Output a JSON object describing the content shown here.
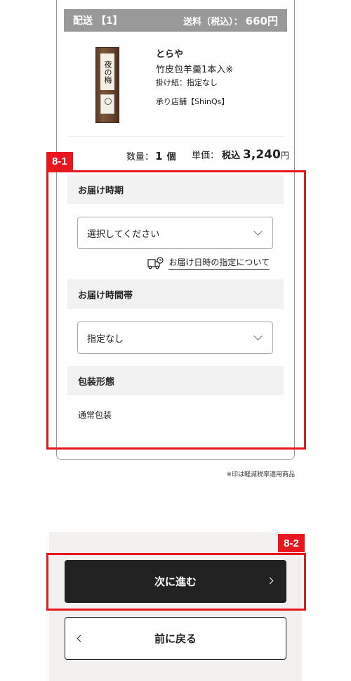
{
  "shipping": {
    "label": "配送 【1】",
    "fee_label": "送料（税込）：",
    "fee_value": "660円"
  },
  "product": {
    "image_label": "夜の梅",
    "brand": "とらや",
    "name": "竹皮包羊羹1本入※",
    "wrapping": "掛け紙：指定なし",
    "store": "承り店舗【ShinQs】"
  },
  "order": {
    "qty_label": "数量：",
    "qty_value": "1",
    "qty_unit": "個",
    "price_label": "単価：",
    "tax_label": "税込",
    "price_value": "3,240",
    "price_unit": "円"
  },
  "delivery_date": {
    "heading": "お届け時期",
    "selected": "選択してください",
    "link_text": "お届け日時の指定について"
  },
  "delivery_time": {
    "heading": "お届け時間帯",
    "selected": "指定なし"
  },
  "packaging": {
    "heading": "包装形態",
    "value": "通常包装"
  },
  "note": "※印は軽減税率適用商品",
  "buttons": {
    "next": "次に進む",
    "back": "前に戻る"
  },
  "annotations": {
    "options_tag": "8-1",
    "next_tag": "8-2",
    "color": "#e8171e"
  },
  "icons": {
    "truck": "truck-clock-icon",
    "chevron": "chevron-down-icon"
  }
}
